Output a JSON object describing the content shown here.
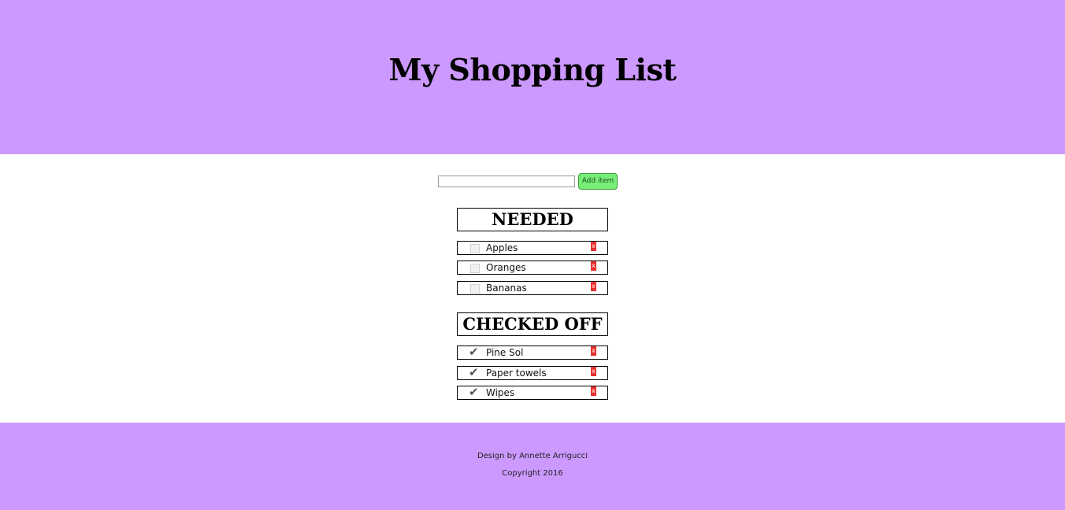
{
  "header": {
    "title": "My Shopping List"
  },
  "add_form": {
    "input_value": "",
    "input_placeholder": "",
    "button_label": "Add item"
  },
  "needed": {
    "heading": "NEEDED",
    "items": [
      {
        "label": "Apples",
        "checked": false,
        "delete_label": "x"
      },
      {
        "label": "Oranges",
        "checked": false,
        "delete_label": "x"
      },
      {
        "label": "Bananas",
        "checked": false,
        "delete_label": "x"
      }
    ]
  },
  "checked_off": {
    "heading": "CHECKED OFF",
    "items": [
      {
        "label": "Pine Sol",
        "checked": true,
        "delete_label": "x"
      },
      {
        "label": "Paper towels",
        "checked": true,
        "delete_label": "x"
      },
      {
        "label": "Wipes",
        "checked": true,
        "delete_label": "x"
      }
    ]
  },
  "footer": {
    "credit": "Design by Annette Arrigucci",
    "copyright": "Copyright 2016"
  },
  "colors": {
    "banner": "#cc99ff",
    "add_button": "#77ee77",
    "delete_button": "#e8302e"
  },
  "icons": {
    "check": "check-icon",
    "delete": "close-icon"
  }
}
